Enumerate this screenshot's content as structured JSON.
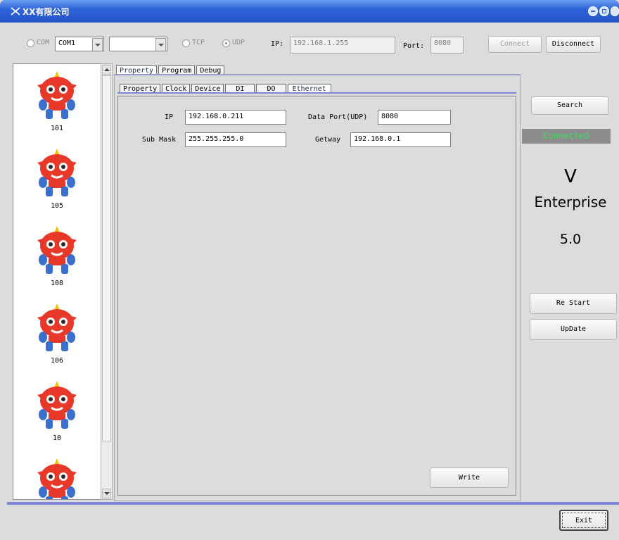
{
  "window": {
    "title": "XX有限公司"
  },
  "toolbar": {
    "com_label": "COM",
    "com_port": "COM1",
    "baud_value": "",
    "tcp_label": "TCP",
    "udp_label": "UDP",
    "ip_label": "IP:",
    "ip_value": "192.168.1.255",
    "port_label": "Port:",
    "port_value": "8080",
    "connect_label": "Connect",
    "disconnect_label": "Disconnect"
  },
  "devices": [
    "101",
    "105",
    "108",
    "106",
    "10",
    ""
  ],
  "main_tabs": [
    "Property",
    "Program",
    "Debug"
  ],
  "sub_tabs": [
    "Property",
    "Clock",
    "Device",
    "DI",
    "DO",
    "Ethernet"
  ],
  "ethernet": {
    "ip_label": "IP",
    "ip_value": "192.168.0.211",
    "mask_label": "Sub Mask",
    "mask_value": "255.255.255.0",
    "dataport_label": "Data Port(UDP)",
    "dataport_value": "8080",
    "gateway_label": "Getway",
    "gateway_value": "192.168.0.1",
    "write_label": "Write"
  },
  "side": {
    "search_label": "Search",
    "status_text": "Connected",
    "version_v": "V",
    "version_name": "Enterprise",
    "version_num": "5.0",
    "restart_label": "Re Start",
    "update_label": "UpDate"
  },
  "footer": {
    "exit_label": "Exit"
  },
  "colors": {
    "titlebar": "#2f64d8",
    "accent_line": "#7b86d8",
    "status_fg": "#32e060",
    "status_bg": "#8c8c8c"
  }
}
